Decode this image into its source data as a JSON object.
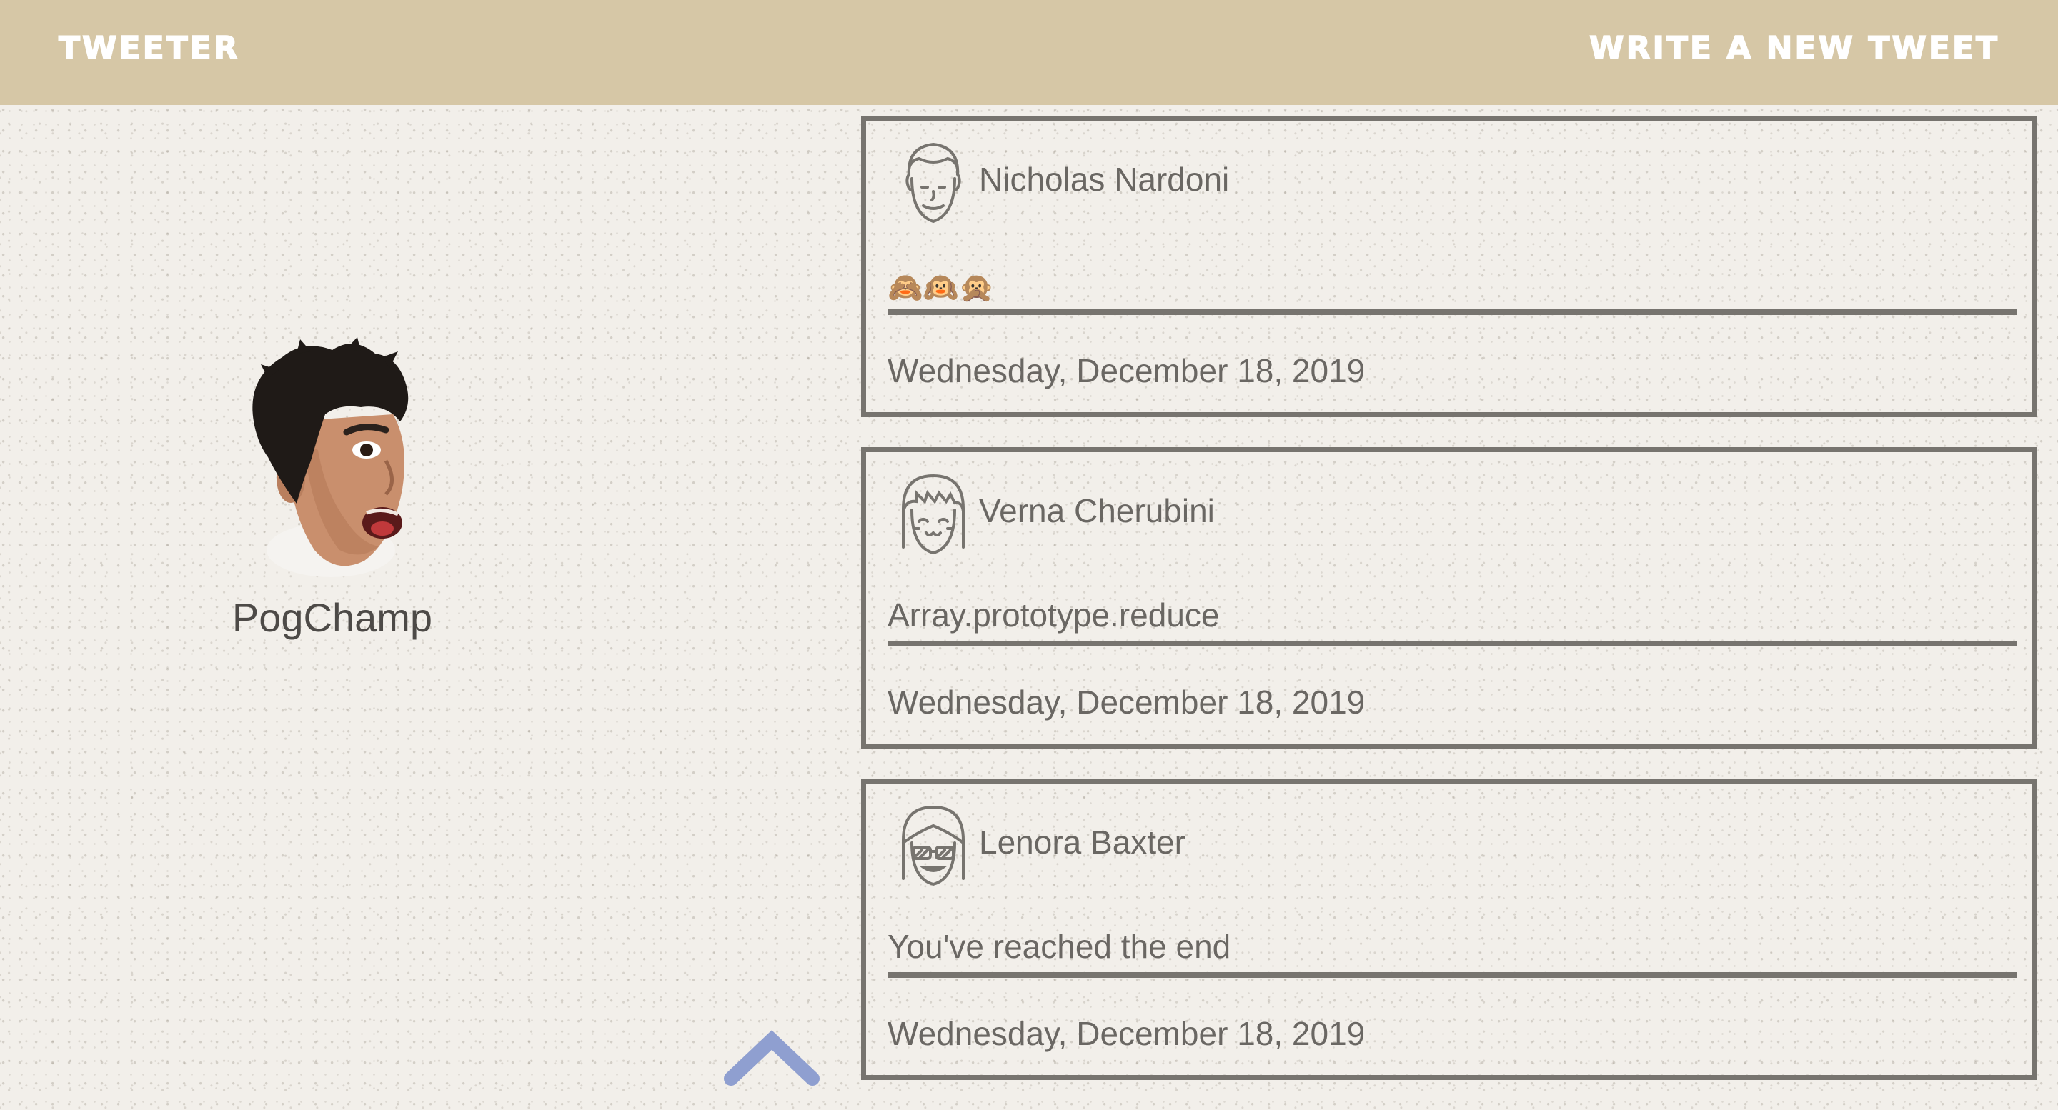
{
  "nav": {
    "brand": "TWEETER",
    "compose_label": "WRITE A NEW TWEET"
  },
  "profile": {
    "name": "PogChamp"
  },
  "tweets": [
    {
      "author": "Nicholas Nardoni",
      "avatar_icon": "smiling-man-face-icon",
      "body": "🙈🙉🙊",
      "date": "Wednesday, December 18, 2019"
    },
    {
      "author": "Verna Cherubini",
      "avatar_icon": "smiling-girl-bangs-icon",
      "body": "Array.prototype.reduce",
      "date": "Wednesday, December 18, 2019"
    },
    {
      "author": "Lenora Baxter",
      "avatar_icon": "girl-sunglasses-icon",
      "body": "You've reached the end",
      "date": "Wednesday, December 18, 2019"
    }
  ],
  "colors": {
    "nav_bg": "#d6c7a6",
    "card_border": "#77746f",
    "scroll_arrow": "#8f9fd0"
  },
  "scroll_icon": "chevron-up-icon"
}
